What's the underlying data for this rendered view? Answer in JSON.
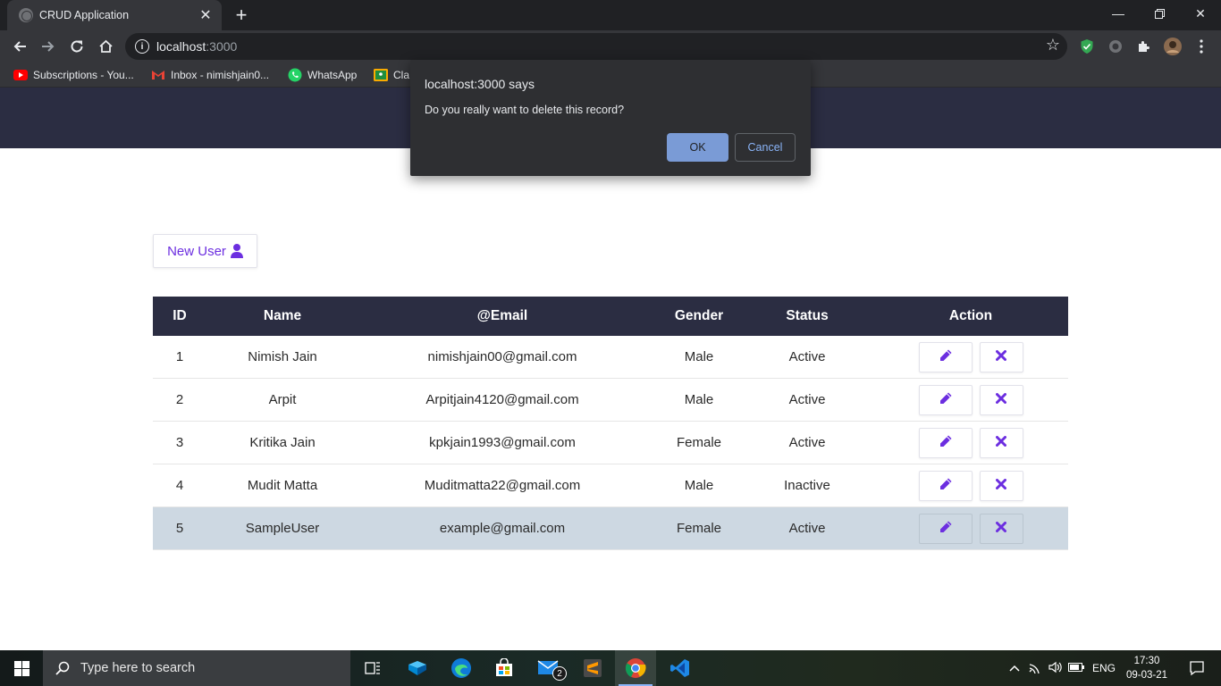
{
  "browser": {
    "tab_title": "CRUD Application",
    "url_host": "localhost",
    "url_port": ":3000",
    "bookmarks": [
      "Subscriptions - You...",
      "Inbox - nimishjain0...",
      "WhatsApp",
      "Cla"
    ]
  },
  "page": {
    "new_user_label": "New User",
    "table": {
      "headers": [
        "ID",
        "Name",
        "@Email",
        "Gender",
        "Status",
        "Action"
      ],
      "rows": [
        {
          "id": "1",
          "name": "Nimish Jain",
          "email": "nimishjain00@gmail.com",
          "gender": "Male",
          "status": "Active"
        },
        {
          "id": "2",
          "name": "Arpit",
          "email": "Arpitjain4120@gmail.com",
          "gender": "Male",
          "status": "Active"
        },
        {
          "id": "3",
          "name": "Kritika Jain",
          "email": "kpkjain1993@gmail.com",
          "gender": "Female",
          "status": "Active"
        },
        {
          "id": "4",
          "name": "Mudit Matta",
          "email": "Muditmatta22@gmail.com",
          "gender": "Male",
          "status": "Inactive"
        },
        {
          "id": "5",
          "name": "SampleUser",
          "email": "example@gmail.com",
          "gender": "Female",
          "status": "Active"
        }
      ]
    }
  },
  "dialog": {
    "title": "localhost:3000 says",
    "message": "Do you really want to delete this record?",
    "ok": "OK",
    "cancel": "Cancel"
  },
  "taskbar": {
    "search_placeholder": "Type here to search",
    "mail_badge": "2",
    "language": "ENG",
    "time": "17:30",
    "date": "09-03-21"
  },
  "colors": {
    "header_bg": "#2b2d42",
    "accent": "#6c2ee0",
    "highlight_row": "#cdd8e2",
    "dialog_bg": "#2e2f32",
    "dialog_ok": "#7a9bd6"
  }
}
